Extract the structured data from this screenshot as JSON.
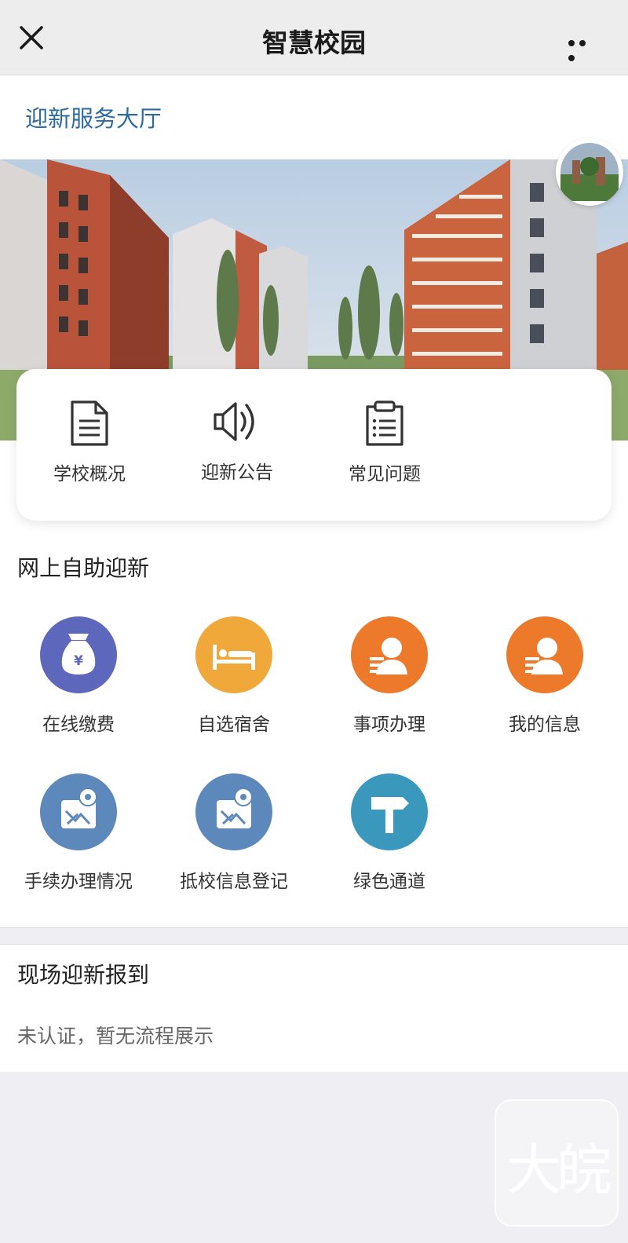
{
  "header": {
    "title": "智慧校园",
    "close_icon": "close-icon",
    "more_icon": "more-icon"
  },
  "hall": {
    "title": "迎新服务大厅"
  },
  "quick_links": [
    {
      "label": "学校概况",
      "icon": "document-icon"
    },
    {
      "label": "迎新公告",
      "icon": "speaker-icon"
    },
    {
      "label": "常见问题",
      "icon": "clipboard-icon"
    }
  ],
  "online_section": {
    "title": "网上自助迎新",
    "items": [
      {
        "label": "在线缴费",
        "icon": "money-bag-icon",
        "color": "#5d68bd"
      },
      {
        "label": "自选宿舍",
        "icon": "bed-icon",
        "color": "#f1a83a"
      },
      {
        "label": "事项办理",
        "icon": "person-card-icon",
        "color": "#ec7a2a"
      },
      {
        "label": "我的信息",
        "icon": "person-card-icon",
        "color": "#ec7a2a"
      },
      {
        "label": "手续办理情况",
        "icon": "map-pin-icon",
        "color": "#5d88bb"
      },
      {
        "label": "抵校信息登记",
        "icon": "map-pin-icon",
        "color": "#5d88bb"
      },
      {
        "label": "绿色通道",
        "icon": "signpost-icon",
        "color": "#3b98bd"
      }
    ]
  },
  "onsite_section": {
    "title": "现场迎新报到",
    "status": "未认证，暂无流程展示"
  },
  "watermark": {
    "text": "大皖"
  }
}
